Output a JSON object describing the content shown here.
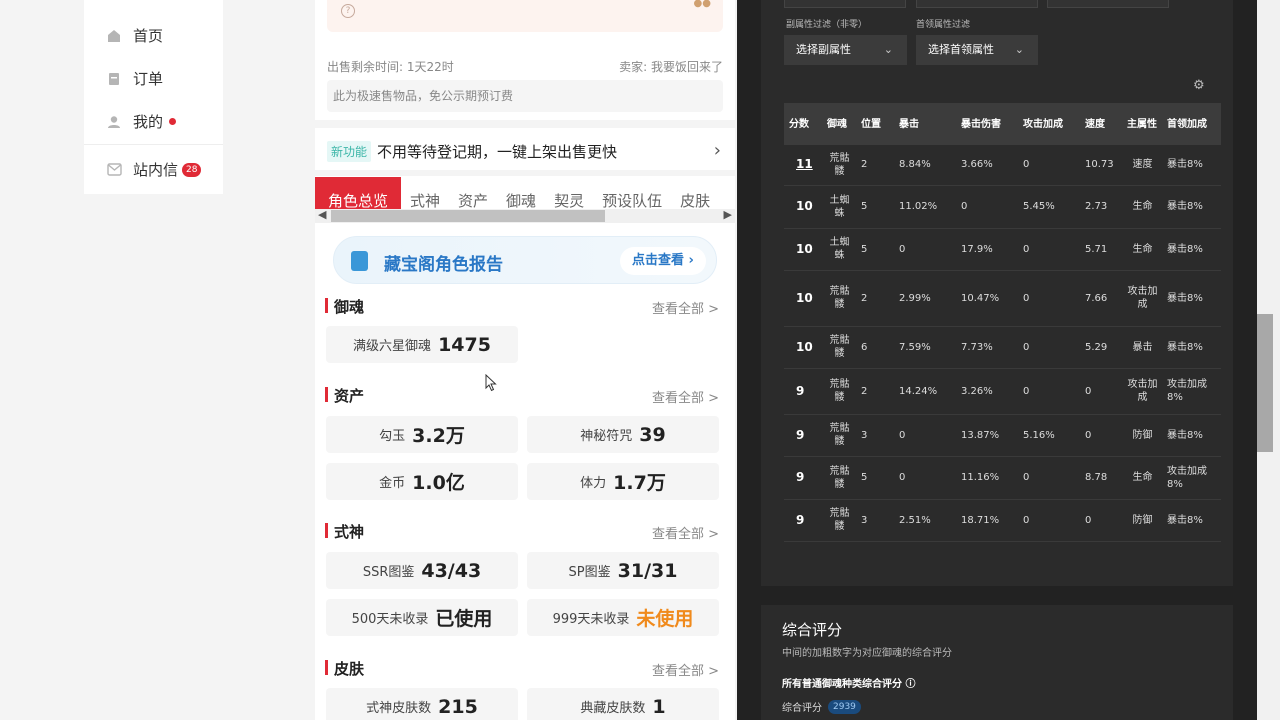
{
  "nav": {
    "items": [
      {
        "label": "首页",
        "icon": "home-icon"
      },
      {
        "label": "订单",
        "icon": "order-icon"
      },
      {
        "label": "我的",
        "icon": "user-icon"
      },
      {
        "label": "站内信",
        "icon": "mail-icon",
        "badge": "28"
      }
    ]
  },
  "listing": {
    "time_left": "出售剩余时间: 1天22时",
    "seller": "卖家: 我要饭回来了",
    "fast_note": "此为极速售物品，免公示期预订费",
    "feature_tag": "新功能",
    "feature_text": "不用等待登记期，一键上架出售更快"
  },
  "tabs": [
    "角色总览",
    "式神",
    "资产",
    "御魂",
    "契灵",
    "预设队伍",
    "皮肤"
  ],
  "report": {
    "title": "藏宝阁角色报告",
    "button": "点击查看 ›"
  },
  "sections": {
    "yuhun": {
      "title": "御魂",
      "more": "查看全部 >",
      "stats": [
        {
          "k": "满级六星御魂",
          "v": "1475"
        }
      ]
    },
    "assets": {
      "title": "资产",
      "more": "查看全部 >",
      "stats": [
        {
          "k": "勾玉",
          "v": "3.2万"
        },
        {
          "k": "神秘符咒",
          "v": "39"
        },
        {
          "k": "金币",
          "v": "1.0亿"
        },
        {
          "k": "体力",
          "v": "1.7万"
        }
      ]
    },
    "shishen": {
      "title": "式神",
      "more": "查看全部 >",
      "stats": [
        {
          "k": "SSR图鉴",
          "v": "43/43"
        },
        {
          "k": "SP图鉴",
          "v": "31/31"
        },
        {
          "k": "500天未收录",
          "v": "已使用"
        },
        {
          "k": "999天未收录",
          "v": "未使用"
        }
      ]
    },
    "skins": {
      "title": "皮肤",
      "more": "查看全部 >",
      "stats": [
        {
          "k": "式神皮肤数",
          "v": "215"
        },
        {
          "k": "典藏皮肤数",
          "v": "1"
        }
      ]
    }
  },
  "filters": {
    "sub_label": "副属性过滤（非零）",
    "sub_select": "选择副属性",
    "lead_label": "首领属性过滤",
    "lead_select": "选择首领属性"
  },
  "table": {
    "headers": [
      "分数",
      "御魂",
      "位置",
      "暴击",
      "暴击伤害",
      "攻击加成",
      "速度",
      "主属性",
      "首领加成"
    ],
    "rows": [
      {
        "score": "11",
        "yh": "荒骷髅",
        "pos": "2",
        "crit": "8.84%",
        "critdmg": "3.66%",
        "atk": "0",
        "spd": "10.73",
        "main": "速度",
        "lead": "暴击8%"
      },
      {
        "score": "10",
        "yh": "土蜘蛛",
        "pos": "5",
        "crit": "11.02%",
        "critdmg": "0",
        "atk": "5.45%",
        "spd": "2.73",
        "main": "生命",
        "lead": "暴击8%"
      },
      {
        "score": "10",
        "yh": "土蜘蛛",
        "pos": "5",
        "crit": "0",
        "critdmg": "17.9%",
        "atk": "0",
        "spd": "5.71",
        "main": "生命",
        "lead": "暴击8%"
      },
      {
        "score": "10",
        "yh": "荒骷髅",
        "pos": "2",
        "crit": "2.99%",
        "critdmg": "10.47%",
        "atk": "0",
        "spd": "7.66",
        "main": "攻击加成",
        "lead": "暴击8%"
      },
      {
        "score": "10",
        "yh": "荒骷髅",
        "pos": "6",
        "crit": "7.59%",
        "critdmg": "7.73%",
        "atk": "0",
        "spd": "5.29",
        "main": "暴击",
        "lead": "暴击8%"
      },
      {
        "score": "9",
        "yh": "荒骷髅",
        "pos": "2",
        "crit": "14.24%",
        "critdmg": "3.26%",
        "atk": "0",
        "spd": "0",
        "main": "攻击加成",
        "lead": "攻击加成8%"
      },
      {
        "score": "9",
        "yh": "荒骷髅",
        "pos": "3",
        "crit": "0",
        "critdmg": "13.87%",
        "atk": "5.16%",
        "spd": "0",
        "main": "防御",
        "lead": "暴击8%"
      },
      {
        "score": "9",
        "yh": "荒骷髅",
        "pos": "5",
        "crit": "0",
        "critdmg": "11.16%",
        "atk": "0",
        "spd": "8.78",
        "main": "生命",
        "lead": "攻击加成8%"
      },
      {
        "score": "9",
        "yh": "荒骷髅",
        "pos": "3",
        "crit": "2.51%",
        "critdmg": "18.71%",
        "atk": "0",
        "spd": "0",
        "main": "防御",
        "lead": "暴击8%"
      }
    ]
  },
  "summary": {
    "title": "综合评分",
    "subtitle": "中间的加粗数字为对应御魂的综合评分",
    "bold": "所有普通御魂种类综合评分",
    "label": "综合评分",
    "value": "2939"
  },
  "colors": {
    "accent": "#e02a36",
    "orange": "#f08a1c",
    "blue": "#2a78c6",
    "dark": "#222222"
  }
}
